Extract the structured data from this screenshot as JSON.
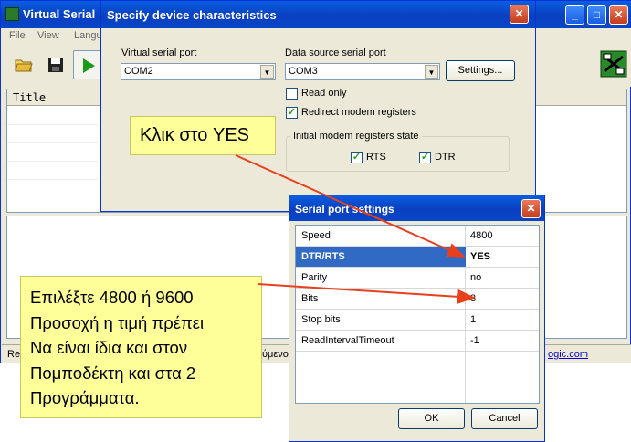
{
  "main_window": {
    "title": "Virtual Serial",
    "menu": [
      "File",
      "View",
      "Langu"
    ],
    "list_header": "Title",
    "status_left": "Re",
    "status_mid": "ύμενο",
    "status_link": "ogic.com"
  },
  "specify_dialog": {
    "title": "Specify device characteristics",
    "virtual_port_label": "Virtual serial port",
    "virtual_port_value": "COM2",
    "source_port_label": "Data source serial port",
    "source_port_value": "COM3",
    "settings_button": "Settings...",
    "read_only_label": "Read only",
    "read_only_checked": false,
    "redirect_label": "Redirect modem registers",
    "redirect_checked": true,
    "group_label": "Initial modem registers state",
    "rts_label": "RTS",
    "rts_checked": true,
    "dtr_label": "DTR",
    "dtr_checked": true
  },
  "settings_dialog": {
    "title": "Serial port settings",
    "rows": [
      {
        "key": "Speed",
        "value": "4800"
      },
      {
        "key": "DTR/RTS",
        "value": "YES"
      },
      {
        "key": "Parity",
        "value": "no"
      },
      {
        "key": "Bits",
        "value": "8"
      },
      {
        "key": "Stop bits",
        "value": "1"
      },
      {
        "key": "ReadIntervalTimeout",
        "value": "-1"
      }
    ],
    "ok_button": "OK",
    "cancel_button": "Cancel"
  },
  "annotations": {
    "click_yes": "Κλικ στο YES",
    "speed_note_lines": [
      "Επιλέξτε 4800 ή 9600",
      "Προσοχή η τιμή πρέπει",
      "Να είναι ίδια και στον",
      "Πομποδέκτη και στα 2",
      "Προγράμματα."
    ],
    "accent_color": "#e8401c",
    "callout_color": "#ffff99"
  },
  "icons": [
    "app-icon",
    "open-folder-icon",
    "save-disk-icon",
    "play-icon",
    "minimize-icon",
    "maximize-icon",
    "close-icon",
    "network-icon",
    "chevron-down-icon",
    "checkmark-icon"
  ]
}
